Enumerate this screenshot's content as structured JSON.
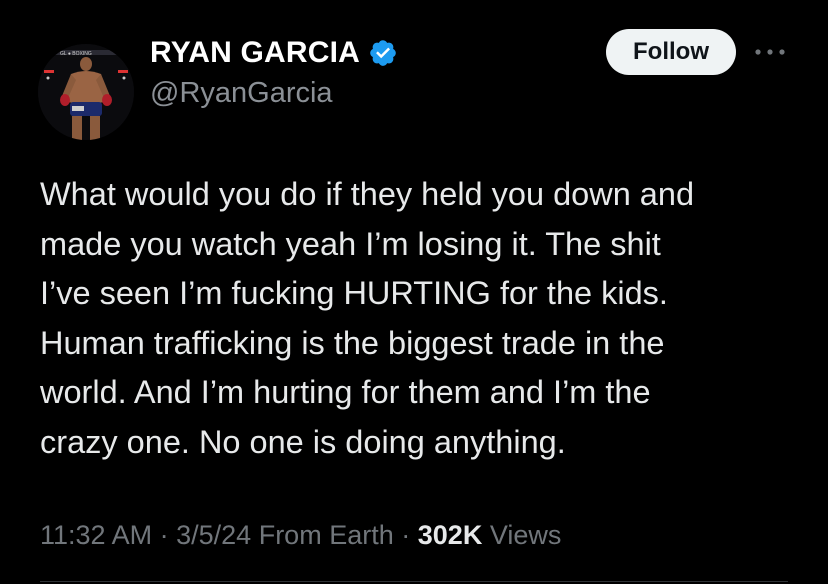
{
  "author": {
    "display_name": "RYAN GARCIA",
    "handle": "@RyanGarcia",
    "verified": true,
    "avatar_icon": "boxer-avatar"
  },
  "actions": {
    "follow_label": "Follow",
    "more_icon": "more-horizontal-icon"
  },
  "tweet": {
    "lines": [
      "What would you do if they held you down and",
      "made you watch yeah I’m losing it. The shit",
      "I’ve seen I’m fucking HURTING for the kids.",
      "Human trafficking is the biggest trade in the",
      "world. And I’m hurting for them and I’m the",
      "crazy one. No one is doing anything."
    ]
  },
  "meta": {
    "time": "11:32 AM",
    "separator": "·",
    "date": "3/5/24",
    "source": "From Earth",
    "views_count": "302K",
    "views_label": "Views"
  },
  "colors": {
    "background": "#000000",
    "verified_badge": "#1d9bf0",
    "follow_button_bg": "#eff3f4",
    "secondary_text": "#71767b"
  }
}
